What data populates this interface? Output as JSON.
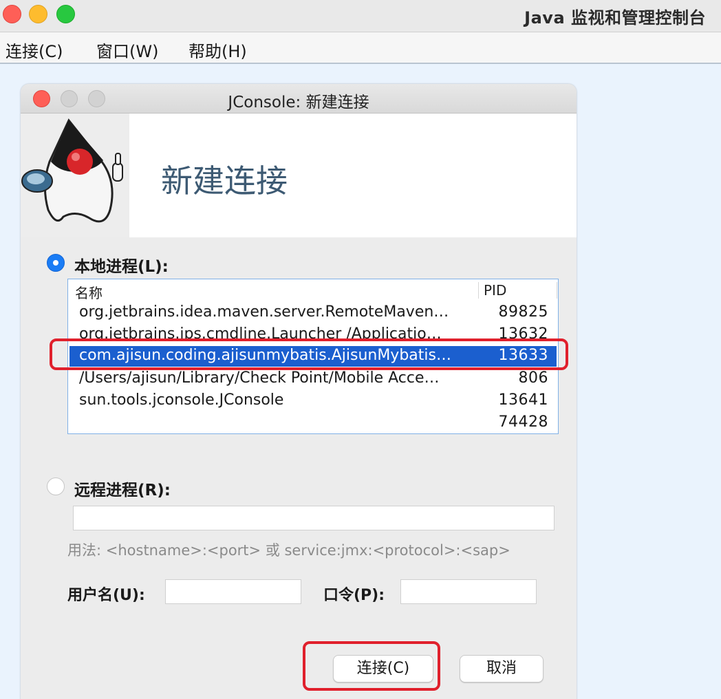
{
  "window": {
    "title": "Java 监视和管理控制台"
  },
  "menubar": {
    "items": [
      "连接(C)",
      "窗口(W)",
      "帮助(H)"
    ]
  },
  "dialog": {
    "title": "JConsole: 新建连接",
    "banner_title": "新建连接",
    "local": {
      "label": "本地进程(L):",
      "selected": true,
      "columns": {
        "name": "名称",
        "pid": "PID"
      },
      "rows": [
        {
          "name": "org.jetbrains.idea.maven.server.RemoteMaven…",
          "pid": "89825"
        },
        {
          "name": "org.jetbrains.jps.cmdline.Launcher /Applicatio…",
          "pid": "13632"
        },
        {
          "name": "com.ajisun.coding.ajisunmybatis.AjisunMybatis…",
          "pid": "13633"
        },
        {
          "name": "/Users/ajisun/Library/Check Point/Mobile Acce…",
          "pid": "806"
        },
        {
          "name": "sun.tools.jconsole.JConsole",
          "pid": "13641"
        },
        {
          "name": "",
          "pid": "74428"
        }
      ],
      "selected_row": 2
    },
    "remote": {
      "label": "远程进程(R):",
      "selected": false,
      "value": "",
      "hint": "用法: <hostname>:<port> 或 service:jmx:<protocol>:<sap>"
    },
    "username_label": "用户名(U):",
    "username_value": "",
    "password_label": "口令(P):",
    "password_value": "",
    "connect_button": "连接(C)",
    "cancel_button": "取消"
  },
  "colors": {
    "selection": "#1b5fcf",
    "radio_selected": "#1a7cf5",
    "annotation": "#e0202c",
    "banner_title": "#3d5a73"
  }
}
